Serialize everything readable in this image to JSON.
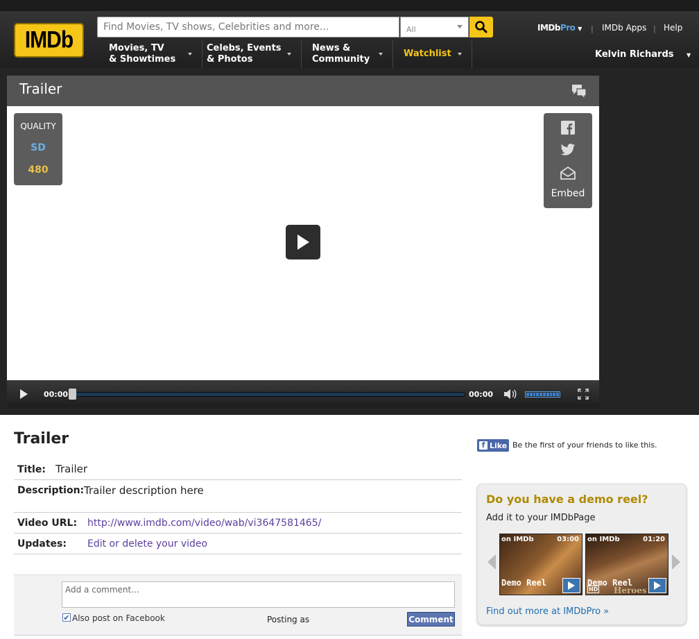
{
  "header": {
    "logo": "IMDb",
    "search_placeholder": "Find Movies, TV shows, Celebrities and more...",
    "category": "All",
    "nav": [
      {
        "line1": "Movies, TV",
        "line2": "& Showtimes"
      },
      {
        "line1": "Celebs, Events",
        "line2": "& Photos"
      },
      {
        "line1": "News &",
        "line2": "Community"
      },
      {
        "line1": "Watchlist",
        "line2": ""
      }
    ],
    "pro_a": "IMDb",
    "pro_b": "Pro",
    "apps": "IMDb Apps",
    "help": "Help",
    "user": "Kelvin Richards",
    "sep": "|"
  },
  "player": {
    "title": "Trailer",
    "quality_label": "QUALITY",
    "quality_sd": "SD",
    "quality_res": "480",
    "embed": "Embed",
    "time_current": "00:00",
    "time_total": "00:00",
    "progress": 0,
    "volume": 1.0
  },
  "details": {
    "heading": "Trailer",
    "title_key": "Title:",
    "title_val": "Trailer",
    "desc_key": "Description:",
    "desc_val": "Trailer description here",
    "url_key": "Video URL:",
    "url_val": "http://www.imdb.com/video/wab/vi3647581465/",
    "updates_key": "Updates:",
    "updates_val": "Edit or delete your video"
  },
  "comments": {
    "placeholder": "Add a comment...",
    "also_post": "Also post on Facebook",
    "also_post_checked": true,
    "posting_as": "Posting as",
    "button": "Comment"
  },
  "sidebar": {
    "like": "Like",
    "like_f": "f",
    "like_text": "Be the first of your friends to like this.",
    "demo_heading": "Do you have a demo reel?",
    "demo_sub": "Add it to your IMDbPage",
    "videos": [
      {
        "badge": "on IMDb",
        "duration": "03:00",
        "label": "Demo Reel",
        "overlay": "",
        "hd": ""
      },
      {
        "badge": "on IMDb",
        "duration": "01:20",
        "label": "Demo Reel",
        "overlay": "Heroes",
        "hd": "HD"
      }
    ],
    "find_more": "Find out more at IMDbPro »"
  }
}
